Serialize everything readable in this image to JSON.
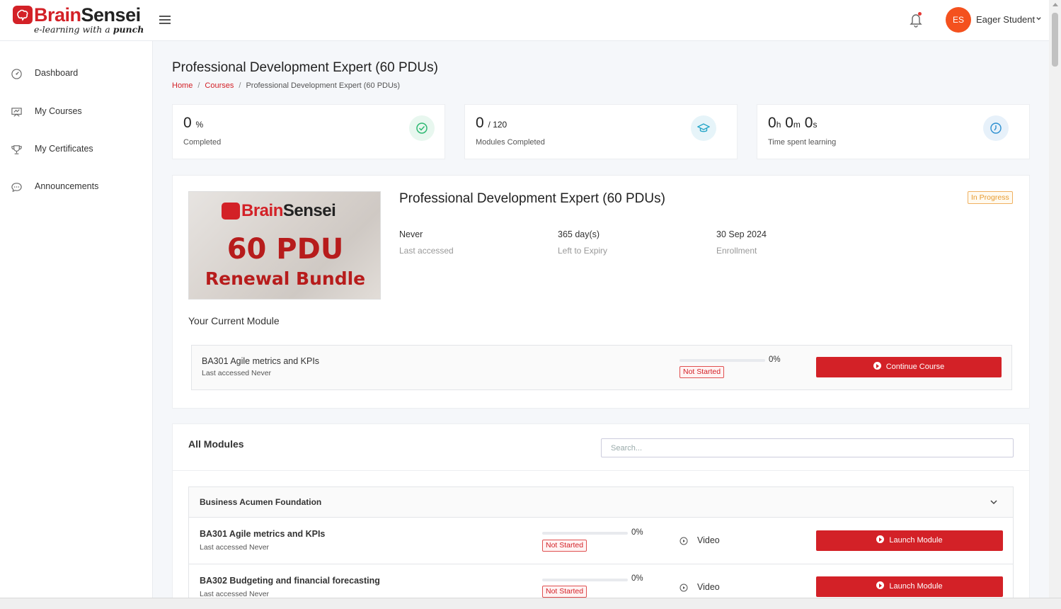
{
  "brand": {
    "name_part1": "Brain",
    "name_part2": "Sensei",
    "tagline_part1": "e-learning with a ",
    "tagline_part2": "punch"
  },
  "header": {
    "user_initials": "ES",
    "user_name": "Eager Student",
    "avatar_color": "#f4511e"
  },
  "sidebar": {
    "items": [
      {
        "label": "Dashboard",
        "icon": "gauge-icon"
      },
      {
        "label": "My Courses",
        "icon": "presentation-board-icon"
      },
      {
        "label": "My Certificates",
        "icon": "trophy-icon"
      },
      {
        "label": "Announcements",
        "icon": "chat-bubble-icon"
      }
    ]
  },
  "page": {
    "title": "Professional Development Expert (60 PDUs)",
    "breadcrumb": {
      "home": "Home",
      "courses": "Courses",
      "current": "Professional Development Expert (60 PDUs)",
      "sep": "/"
    }
  },
  "stats": {
    "completed": {
      "value": "0",
      "unit": "%",
      "label": "Completed",
      "icon": "check-circle-icon"
    },
    "modules": {
      "value": "0",
      "total": "/ 120",
      "label": "Modules Completed",
      "icon": "graduation-cap-icon"
    },
    "time": {
      "h": "0",
      "h_unit": "h",
      "m": "0",
      "m_unit": "m",
      "s": "0",
      "s_unit": "s",
      "label": "Time spent learning",
      "icon": "clock-icon"
    }
  },
  "course": {
    "title": "Professional Development Expert (60 PDUs)",
    "status": "In Progress",
    "image": {
      "brand_part1": "Brain",
      "brand_part2": "Sensei",
      "big": "60 PDU",
      "sub": "Renewal Bundle"
    },
    "meta": [
      {
        "value": "Never",
        "label": "Last accessed"
      },
      {
        "value": "365 day(s)",
        "label": "Left to Expiry"
      },
      {
        "value": "30 Sep 2024",
        "label": "Enrollment"
      }
    ],
    "current_heading": "Your Current Module",
    "current_module": {
      "title": "BA301 Agile metrics and KPIs",
      "last_accessed": "Last accessed Never",
      "progress_pct": "0%",
      "progress_value": 0,
      "status": "Not Started",
      "button": "Continue Course"
    }
  },
  "modules": {
    "title": "All Modules",
    "search_placeholder": "Search...",
    "groups": [
      {
        "title": "Business Acumen Foundation",
        "items": [
          {
            "title": "BA301 Agile metrics and KPIs",
            "last_accessed": "Last accessed Never",
            "progress_pct": "0%",
            "progress_value": 0,
            "status": "Not Started",
            "type": "Video",
            "button": "Launch Module"
          },
          {
            "title": "BA302 Budgeting and financial forecasting",
            "last_accessed": "Last accessed Never",
            "progress_pct": "0%",
            "progress_value": 0,
            "status": "Not Started",
            "type": "Video",
            "button": "Launch Module"
          }
        ]
      }
    ]
  },
  "colors": {
    "brand_red": "#d32127",
    "in_progress": "#e79a2e",
    "completed_icon": "#2eb872",
    "modules_icon": "#26a6c8",
    "time_icon": "#2b8fd0"
  }
}
